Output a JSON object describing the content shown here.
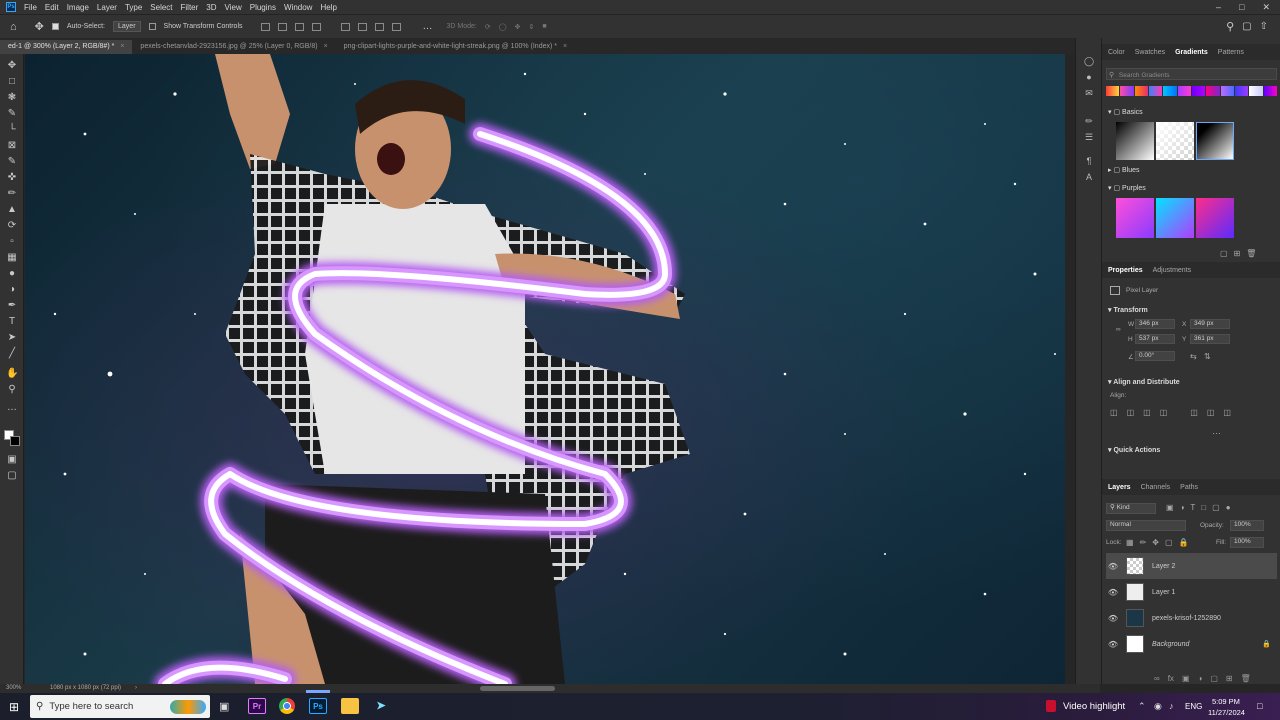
{
  "app": {
    "logo_text": "Ps",
    "menu": [
      "File",
      "Edit",
      "Image",
      "Layer",
      "Type",
      "Select",
      "Filter",
      "3D",
      "View",
      "Plugins",
      "Window",
      "Help"
    ]
  },
  "options": {
    "auto_select_label": "Auto-Select:",
    "auto_select_target": "Layer",
    "show_transform_label": "Show Transform Controls",
    "mode_3d_label": "3D Mode:"
  },
  "tabs": [
    {
      "label": "ed-1 @ 300% (Layer 2, RGB/8#) *",
      "active": true
    },
    {
      "label": "pexels-chetanvlad-2923156.jpg @ 25% (Layer 0, RGB/8)",
      "active": false
    },
    {
      "label": "png-clipart-lights-purple-and-white-light-streak.png @ 100% (Index) *",
      "active": false
    }
  ],
  "panel_tabs_top": {
    "items": [
      "Color",
      "Swatches",
      "Gradients",
      "Patterns"
    ],
    "active": "Gradients"
  },
  "gradients": {
    "search_placeholder": "Search Gradients",
    "groups": [
      {
        "name": "Basics",
        "expanded": true
      },
      {
        "name": "Blues",
        "expanded": false
      },
      {
        "name": "Purples",
        "expanded": true
      }
    ]
  },
  "properties": {
    "tabs": [
      "Properties",
      "Adjustments"
    ],
    "active": "Properties",
    "kind": "Pixel Layer",
    "transform_label": "Transform",
    "w_label": "W",
    "w_value": "346 px",
    "h_label": "H",
    "h_value": "537 px",
    "x_label": "X",
    "x_value": "349 px",
    "y_label": "Y",
    "y_value": "361 px",
    "angle_value": "0.00°",
    "align_label": "Align and Distribute",
    "align_sub": "Align:",
    "quick_actions": "Quick Actions"
  },
  "layers_panel": {
    "tabs": [
      "Layers",
      "Channels",
      "Paths"
    ],
    "active": "Layers",
    "filter_kind": "Kind",
    "blend_mode": "Normal",
    "opacity_label": "Opacity:",
    "opacity_value": "100%",
    "lock_label": "Lock:",
    "fill_label": "Fill:",
    "fill_value": "100%",
    "layers": [
      {
        "name": "Layer 2",
        "selected": true
      },
      {
        "name": "Layer 1",
        "selected": false
      },
      {
        "name": "pexels-krisof-1252890",
        "selected": false
      },
      {
        "name": "Background",
        "selected": false,
        "locked": true
      }
    ]
  },
  "status": {
    "zoom": "300%",
    "doc_info": "1080 px x 1080 px (72 ppi)"
  },
  "taskbar": {
    "search_placeholder": "Type here to search",
    "video_highlight": "Video highlight",
    "language": "ENG",
    "time": "5:09 PM",
    "date": "11/27/2024",
    "app_icons": [
      "Pr",
      "Chrome",
      "Ps",
      "Files",
      "App"
    ]
  },
  "colors": {
    "accent": "#31a8ff",
    "light_streak": "#c87af0",
    "panel_bg": "#323232"
  }
}
